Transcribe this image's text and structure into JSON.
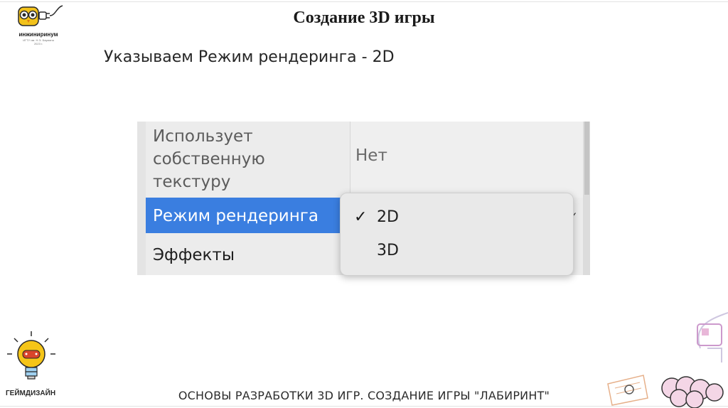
{
  "branding": {
    "logo_name": "инжиниринум",
    "logo_sub_line1": "ИГТУ им. Н.Э. Баумана",
    "logo_sub_line2": "2023 г.",
    "bottom_logo_text": "ГЕЙМДИЗАЙН"
  },
  "slide": {
    "title": "Создание 3D игры",
    "subtitle": "Указываем Режим рендеринга - 2D",
    "footer": "ОСНОВЫ РАЗРАБОТКИ 3D ИГР. СОЗДАНИЕ ИГРЫ \"ЛАБИРИНТ\""
  },
  "properties": {
    "texture_label_lines": [
      "Использует",
      "собственную",
      "текстуру"
    ],
    "texture_value": "Нет",
    "render_mode_label": "Режим рендеринга",
    "effects_label": "Эффекты",
    "right_check": "✓"
  },
  "dropdown": {
    "options": [
      {
        "label": "2D",
        "checked": true,
        "check": "✓"
      },
      {
        "label": "3D",
        "checked": false,
        "check": ""
      }
    ]
  },
  "colors": {
    "selection": "#3a7ee0",
    "panel_bg": "#ececec"
  }
}
